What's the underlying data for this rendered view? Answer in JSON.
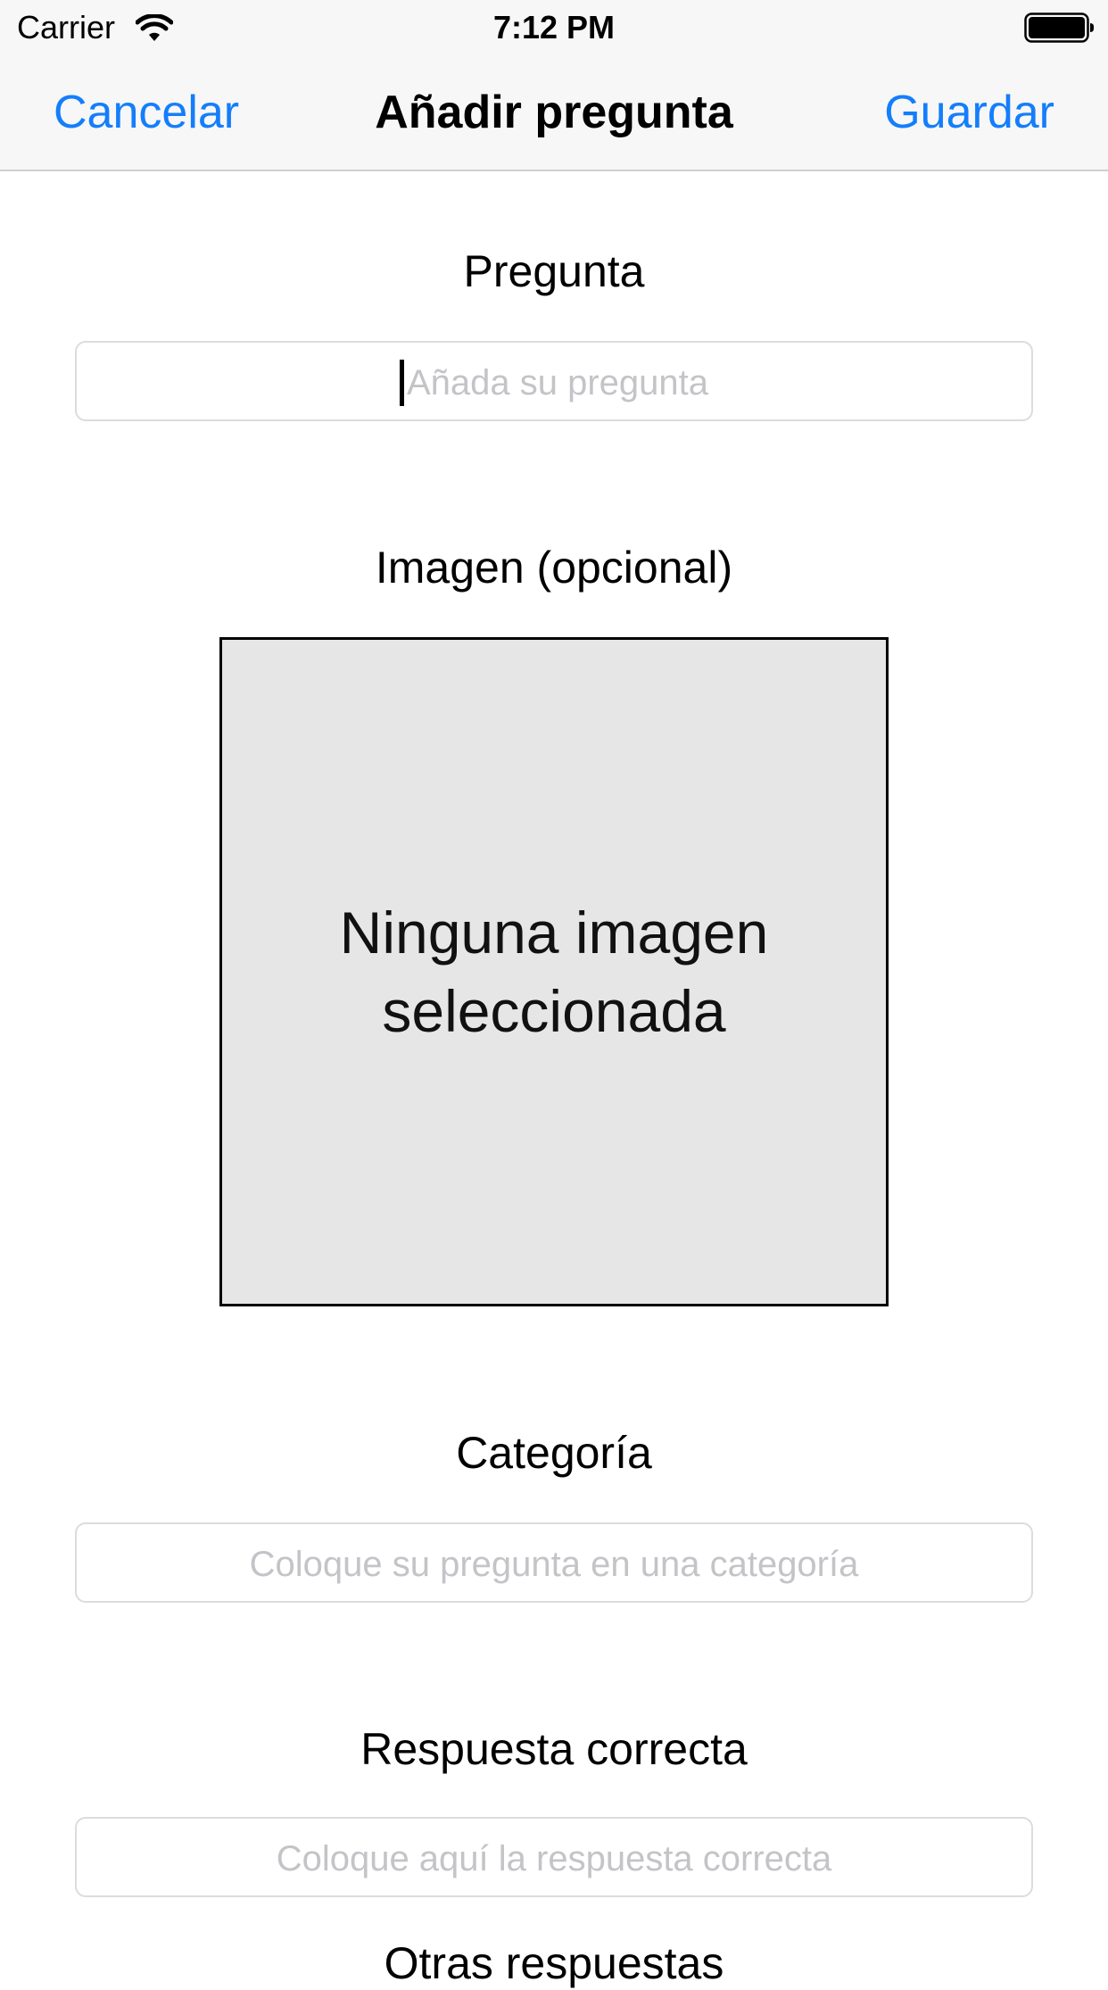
{
  "status_bar": {
    "carrier": "Carrier",
    "time": "7:12 PM",
    "wifi_icon": "wifi-icon",
    "battery_icon": "battery-icon"
  },
  "nav": {
    "cancel_label": "Cancelar",
    "title": "Añadir pregunta",
    "save_label": "Guardar",
    "accent_color": "#147efb"
  },
  "form": {
    "question": {
      "label": "Pregunta",
      "placeholder": "Añada su pregunta",
      "value": ""
    },
    "image": {
      "label": "Imagen (opcional)",
      "empty_text": "Ninguna imagen seleccionada"
    },
    "category": {
      "label": "Categoría",
      "placeholder": "Coloque su pregunta en una categoría",
      "value": ""
    },
    "correct_answer": {
      "label": "Respuesta correcta",
      "placeholder": "Coloque aquí la respuesta correcta",
      "value": ""
    },
    "other_answers": {
      "label": "Otras respuestas"
    }
  }
}
